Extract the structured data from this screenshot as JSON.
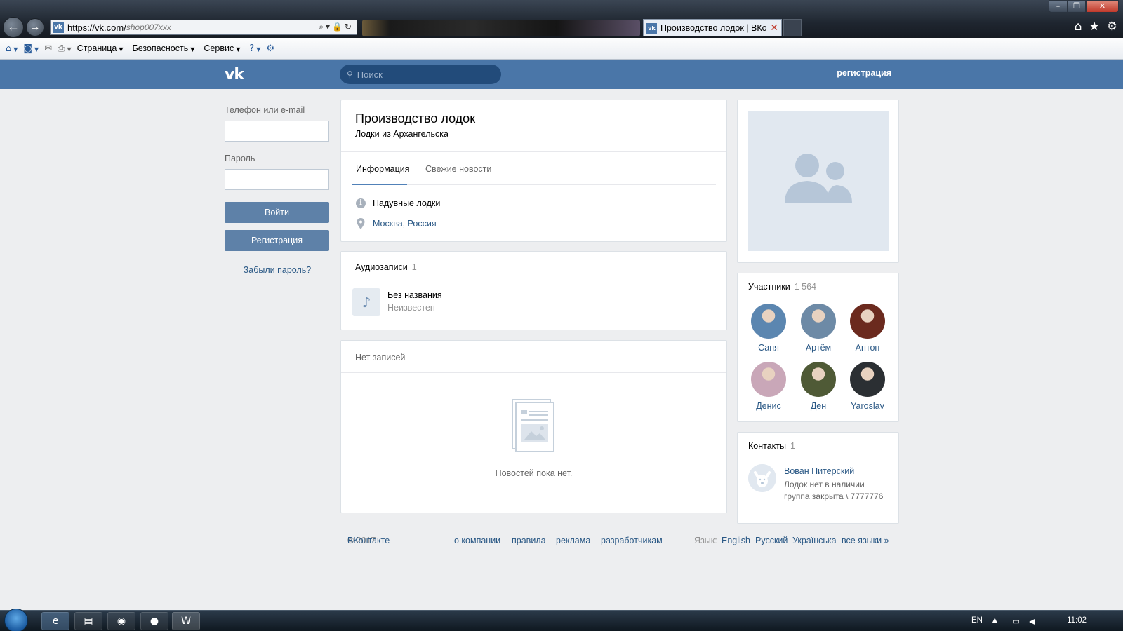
{
  "browser": {
    "url_host": "https://vk.com/",
    "url_path": "shop007xxx",
    "active_tab_title": "Производство лодок | ВКо...",
    "menu": [
      "Страница",
      "Безопасность",
      "Сервис"
    ],
    "favicon_text": "vk"
  },
  "header": {
    "logo": "vk",
    "search_placeholder": "Поиск",
    "register_link": "регистрация"
  },
  "login": {
    "phone_label": "Телефон или e-mail",
    "password_label": "Пароль",
    "login_button": "Войти",
    "register_button": "Регистрация",
    "forgot_link": "Забыли пароль?"
  },
  "group": {
    "name": "Производство лодок",
    "status": "Лодки из Архангельска",
    "tabs": [
      "Информация",
      "Свежие новости"
    ],
    "description": "Надувные лодки",
    "location": "Москва, Россия"
  },
  "audio": {
    "title": "Аудиозаписи",
    "count": "1",
    "track_title": "Без названия",
    "track_artist": "Неизвестен"
  },
  "wall": {
    "title": "Нет записей",
    "empty_text": "Новостей пока нет."
  },
  "members": {
    "title": "Участники",
    "count": "1 564",
    "items": [
      {
        "name": "Саня",
        "color": "#5b86b0"
      },
      {
        "name": "Артём",
        "color": "#6d8aa6"
      },
      {
        "name": "Антон",
        "color": "#6b2a1e"
      },
      {
        "name": "Денис",
        "color": "#c9a7b8"
      },
      {
        "name": "Ден",
        "color": "#4f5a36"
      },
      {
        "name": "Yaroslav",
        "color": "#2b2f33"
      }
    ]
  },
  "contacts": {
    "title": "Контакты",
    "count": "1",
    "name": "Вован Питерский",
    "description": "Лодок нет в наличии группа закрыта \\ 7777776"
  },
  "footer": {
    "brand": "ВКонтакте",
    "year": "© 2017",
    "links": [
      "о компании",
      "правила",
      "реклама",
      "разработчикам"
    ],
    "lang_label": "Язык:",
    "langs": [
      "English",
      "Русский",
      "Українська",
      "все языки »"
    ]
  },
  "taskbar": {
    "lang": "EN",
    "time": "11:02"
  },
  "colors": {
    "vk_blue": "#4a76a8",
    "link": "#2a5885",
    "background": "#edeef0"
  }
}
